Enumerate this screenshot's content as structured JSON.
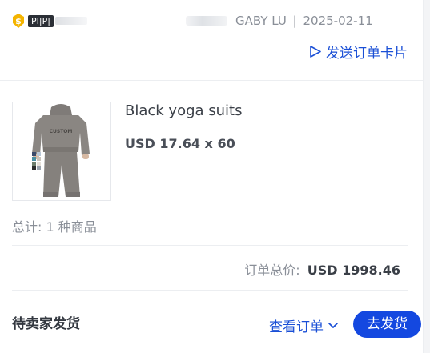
{
  "header": {
    "badge_label": "PI|P|",
    "seller_name": "GABY LU",
    "separator": "|",
    "order_date": "2025-02-11",
    "send_card_label": "发送订单卡片"
  },
  "product": {
    "name": "Black yoga suits",
    "price_line": "USD 17.64 x 60",
    "image_text": "CUSTOM"
  },
  "summary": {
    "total_items": "总计: 1 种商品",
    "order_total_label": "订单总价:",
    "order_total_amount": "USD 1998.46"
  },
  "footer": {
    "status": "待卖家发货",
    "view_order_label": "查看订单",
    "ship_button_label": "去发货"
  },
  "icons": {
    "badge": "coin-icon",
    "send": "send-icon",
    "view_order": "chevron-down-icon"
  },
  "colors": {
    "accent": "#1448e0",
    "link": "#1a4fd6",
    "coin": "#f4b400",
    "muted_text": "#8a8f98"
  }
}
